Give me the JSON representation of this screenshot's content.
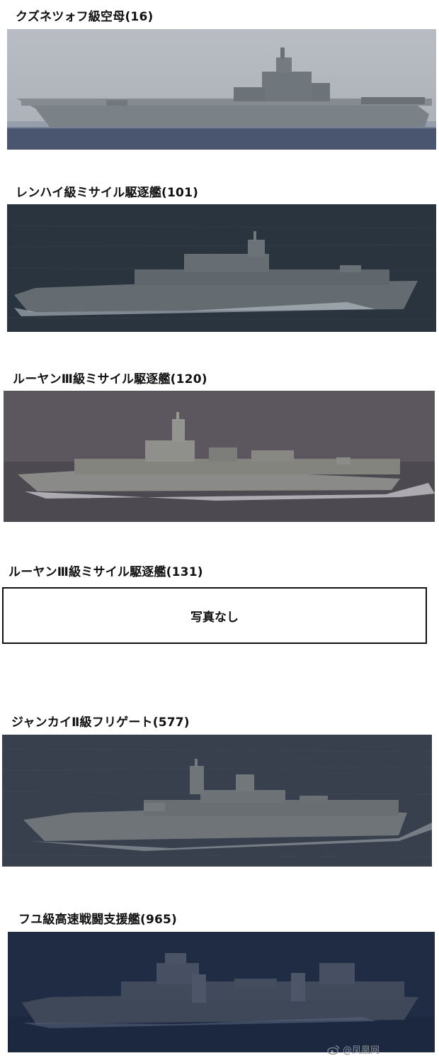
{
  "items": [
    {
      "caption": "クズネツォフ級空母(16)",
      "photo": true,
      "sky": "#b7bcc2",
      "sea": "#44506a",
      "ship": "#7d8388"
    },
    {
      "caption": "レンハイ級ミサイル駆逐艦(101)",
      "photo": true,
      "sky": "#2c3640",
      "sea": "#26303b",
      "ship": "#6a7276"
    },
    {
      "caption": "ルーヤンⅢ級ミサイル駆逐艦(120)",
      "photo": true,
      "sky": "#5e5960",
      "sea": "#4e4a52",
      "ship": "#8a8a88"
    },
    {
      "caption": "ルーヤンⅢ級ミサイル駆逐艦(131)",
      "photo": false,
      "placeholder": "写真なし"
    },
    {
      "caption": "ジャンカイⅡ級フリゲート(577)",
      "photo": true,
      "sky": "#3a4350",
      "sea": "#323b48",
      "ship": "#6f7478"
    },
    {
      "caption": "フユ級高速戦闘支援艦(965)",
      "photo": true,
      "sky": "#1f2d45",
      "sea": "#1b2a44",
      "ship": "#424b5a"
    }
  ],
  "watermark": {
    "text": "@凤凰网"
  }
}
